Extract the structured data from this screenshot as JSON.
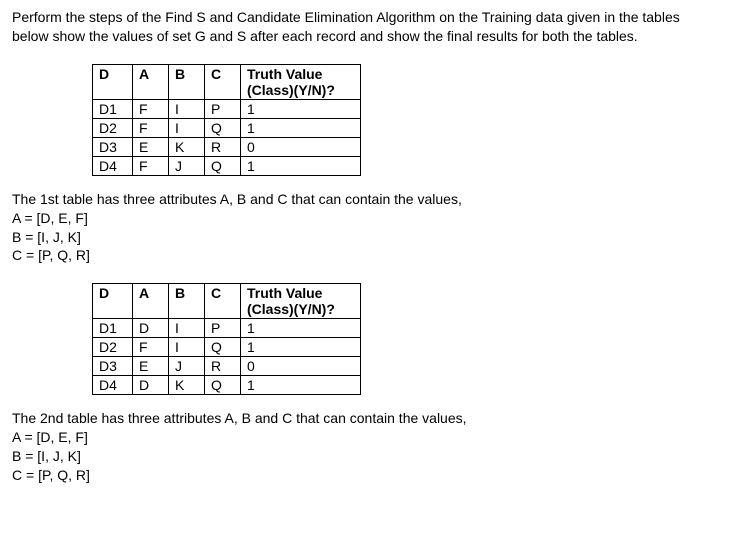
{
  "intro": "Perform the steps of the Find S and Candidate Elimination Algorithm on the Training data given in the tables below show the values of set G and S after each record and show the final results for both the tables.",
  "headers": {
    "D": "D",
    "A": "A",
    "B": "B",
    "C": "C",
    "TV_line1": "Truth Value",
    "TV_line2": "(Class)(Y/N)?"
  },
  "table1": {
    "rows": [
      {
        "D": "D1",
        "A": "F",
        "B": "I",
        "C": "P",
        "TV": "1"
      },
      {
        "D": "D2",
        "A": "F",
        "B": "I",
        "C": "Q",
        "TV": "1"
      },
      {
        "D": "D3",
        "A": "E",
        "B": "K",
        "C": "R",
        "TV": "0"
      },
      {
        "D": "D4",
        "A": "F",
        "B": "J",
        "C": "Q",
        "TV": "1"
      }
    ]
  },
  "desc1": {
    "line1": "The 1st table has three attributes A, B and C that can contain the values,",
    "lineA": "A = [D, E, F]",
    "lineB": "B = [I, J, K]",
    "lineC": "C = [P, Q, R]"
  },
  "table2": {
    "rows": [
      {
        "D": "D1",
        "A": "D",
        "B": "I",
        "C": "P",
        "TV": "1"
      },
      {
        "D": "D2",
        "A": "F",
        "B": "I",
        "C": "Q",
        "TV": "1"
      },
      {
        "D": "D3",
        "A": "E",
        "B": "J",
        "C": "R",
        "TV": "0"
      },
      {
        "D": "D4",
        "A": "D",
        "B": "K",
        "C": "Q",
        "TV": "1"
      }
    ]
  },
  "desc2": {
    "line1": "The 2nd table has three attributes A, B and C that can contain the values,",
    "lineA": "A = [D, E, F]",
    "lineB": "B = [I, J, K]",
    "lineC": "C = [P, Q, R]"
  }
}
